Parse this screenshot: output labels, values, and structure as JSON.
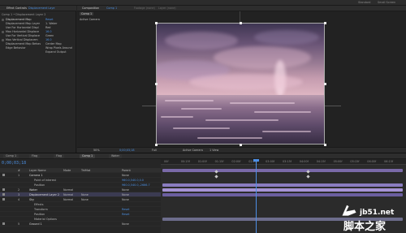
{
  "topbar": {
    "right_labels": [
      "Standard",
      "Small Screen"
    ]
  },
  "effects_panel": {
    "tab_label": "Effect Controls",
    "tab_item": "Displacement Laye",
    "layer_title": "Comp 1 • Displacement Layer 2",
    "rows": [
      {
        "label": "Displacement Map",
        "value": "Reset"
      },
      {
        "label": "Displacement Map Layer",
        "value": "1. Water"
      },
      {
        "label": "Use For Horizontal Displ",
        "value": "Red"
      },
      {
        "label": "Max Horizontal Displace",
        "value": "16.0"
      },
      {
        "label": "Use For Vertical Displace",
        "value": "Green"
      },
      {
        "label": "Max Vertical Displacem",
        "value": "16.0"
      },
      {
        "label": "Displacement Map Behav",
        "value": "Center Map"
      },
      {
        "label": "Edge Behavior",
        "value": "Wrap Pixels Around"
      },
      {
        "label": "",
        "value": "Expand Output"
      }
    ]
  },
  "composition_panel": {
    "tab_label": "Composition",
    "tab_item": "Comp 1",
    "other_tabs": [
      "Footage (none)",
      "Layer (none)"
    ],
    "sub_tab": "Comp 1",
    "viewer_label": "Active Camera",
    "zoom": "50%",
    "timecode": "0;00;03;18",
    "resolution": "Full",
    "camera": "Active Camera",
    "view": "1 View"
  },
  "timeline": {
    "tabs": [
      "Comp 1",
      "Flag",
      "Flag",
      "Comp 1",
      "Water"
    ],
    "active_tab_index": 3,
    "timecode": "0;00;03;18",
    "columns": [
      "#",
      "Layer Name",
      "Mode",
      "TrkMat",
      "Parent"
    ],
    "layers": [
      {
        "num": "1",
        "name": "Camera 1",
        "mode": "",
        "trkmat": "",
        "parent": "None"
      },
      {
        "num": "",
        "name": "Point of Interest",
        "mode": "",
        "trkmat": "",
        "parent": "960.0,540.0,0.0"
      },
      {
        "num": "",
        "name": "Position",
        "mode": "",
        "trkmat": "",
        "parent": "960.0,540.0,-2666.7"
      },
      {
        "num": "2",
        "name": "Water",
        "mode": "Normal",
        "trkmat": "",
        "parent": "None"
      },
      {
        "num": "3",
        "name": "Displacement Layer 2",
        "mode": "Normal",
        "trkmat": "None",
        "parent": "None"
      },
      {
        "num": "4",
        "name": "Sky",
        "mode": "Normal",
        "trkmat": "None",
        "parent": "None"
      },
      {
        "num": "",
        "name": "Effects",
        "mode": "",
        "trkmat": "",
        "parent": ""
      },
      {
        "num": "",
        "name": "Transform",
        "mode": "",
        "trkmat": "",
        "parent": "Reset"
      },
      {
        "num": "",
        "name": "Position",
        "mode": "",
        "trkmat": "",
        "parent": "Reset"
      },
      {
        "num": "",
        "name": "Material Options",
        "mode": "",
        "trkmat": "",
        "parent": ""
      },
      {
        "num": "5",
        "name": "Ground 1",
        "mode": "",
        "trkmat": "",
        "parent": "None"
      }
    ],
    "bar_colors": [
      "#7a6aa8",
      "#8a7cc0",
      "#a593d4",
      "#6b5fa0",
      "#6d6d8c"
    ],
    "ruler_ticks": [
      "00f",
      "00:15f",
      "01:00f",
      "01:15f",
      "02:00f",
      "02:15f",
      "03:00f",
      "03:15f",
      "04:00f",
      "04:15f",
      "05:00f",
      "05:15f",
      "06:00f",
      "06:15f"
    ]
  },
  "watermark": {
    "url": "jb51.net",
    "chinese": "脚本之家"
  },
  "icons": {
    "watermark_hand": "hand-pointer-icon",
    "expand": "triangle-icon",
    "visibility": "eye-icon"
  },
  "colors": {
    "accent": "#4c8fe0",
    "playhead": "#4d8fe6"
  }
}
